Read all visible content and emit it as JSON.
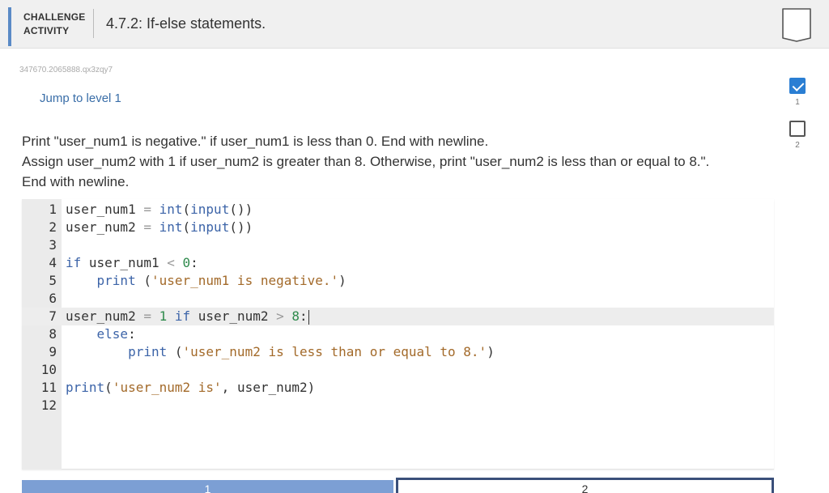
{
  "header": {
    "activity_type_line1": "CHALLENGE",
    "activity_type_line2": "ACTIVITY",
    "title": "4.7.2: If-else statements."
  },
  "activity_id": "347670.2065888.qx3zqy7",
  "jump_link": "Jump to level 1",
  "levels": [
    {
      "label": "1",
      "completed": true
    },
    {
      "label": "2",
      "completed": false
    }
  ],
  "instructions": [
    "Print \"user_num1 is negative.\" if user_num1 is less than 0. End with newline.",
    "Assign user_num2 with 1 if user_num2 is greater than 8. Otherwise, print \"user_num2 is less than or equal to 8.\".",
    "End with newline."
  ],
  "code": {
    "line_numbers": [
      "1",
      "2",
      "3",
      "4",
      "5",
      "6",
      "7",
      "8",
      "9",
      "10",
      "11",
      "12"
    ],
    "lines": [
      "user_num1 = int(input())",
      "user_num2 = int(input())",
      "",
      "if user_num1 < 0:",
      "    print ('user_num1 is negative.')",
      "",
      "user_num2 = 1 if user_num2 > 8:",
      "    else:",
      "        print ('user_num2 is less than or equal to 8.')",
      "",
      "print('user_num2 is', user_num2)",
      ""
    ],
    "active_line": 7
  },
  "bottom_buttons": [
    "1",
    "2"
  ],
  "colors": {
    "accent": "#5a8ac6",
    "link": "#3a6ea8",
    "keyword": "#3c64a8",
    "string": "#a36a2a",
    "number": "#2e8a4c",
    "check": "#2a7ed3"
  }
}
